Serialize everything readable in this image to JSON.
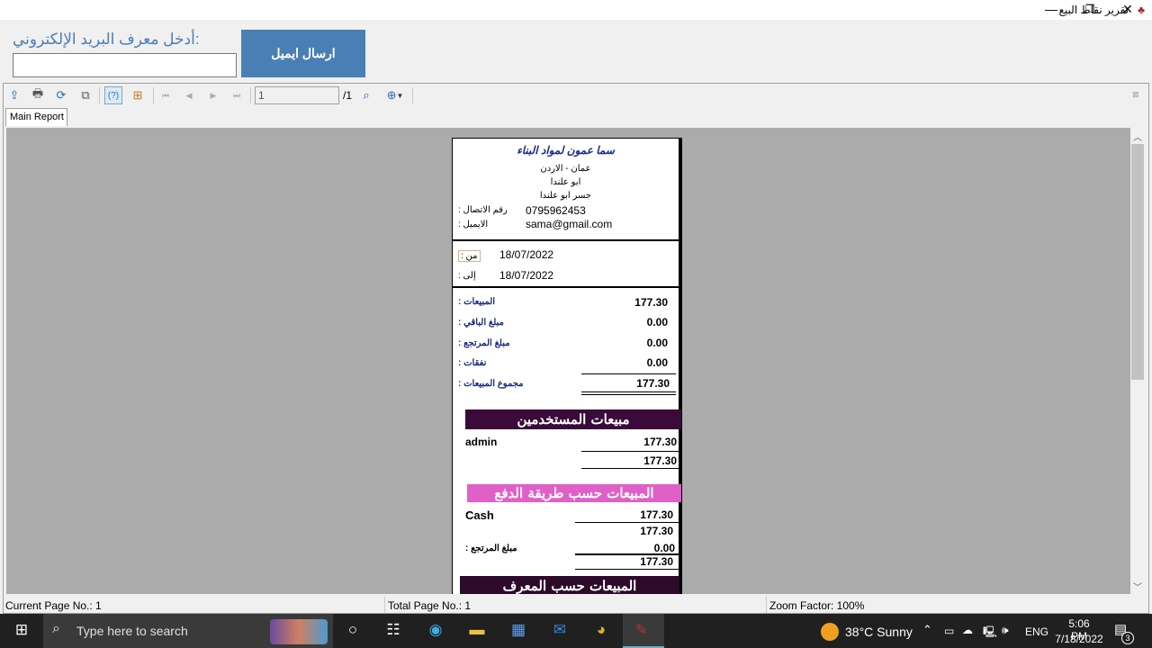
{
  "window": {
    "title": "تقرير نقاط البيع",
    "icon": "app-icon",
    "minimize": "—",
    "maximize": "❐",
    "close": "✕"
  },
  "header": {
    "email_label": ":أدخل معرف البريد الإلكتروني",
    "email_value": "",
    "send_button": "ارسال ايميل",
    "button_color": "#4a7fb5"
  },
  "toolbar": {
    "page_value": "1",
    "page_total": "/1",
    "icons": [
      "export-icon",
      "print-icon",
      "refresh-icon",
      "copy-icon",
      "help-icon",
      "group-tree-icon",
      "first-page-icon",
      "prev-page-icon",
      "next-page-icon",
      "last-page-icon",
      "find-icon",
      "zoom-icon"
    ]
  },
  "tabs": [
    {
      "label": "Main Report"
    }
  ],
  "report": {
    "company": "سما عمون لمواد البناء",
    "address": [
      "عمان - الاردن",
      "ابو علندا",
      "جسر ابو علندا"
    ],
    "phone_label": "رقم الاتصال :",
    "phone": "0795962453",
    "email_label": "الايميل :",
    "email": "sama@gmail.com",
    "from_label": "من :",
    "from": "18/07/2022",
    "to_label": "إلى :",
    "to": "18/07/2022",
    "summary": [
      {
        "label": "المبيعات :",
        "value": "177.30"
      },
      {
        "label": "مبلغ الباقي :",
        "value": "0.00"
      },
      {
        "label": "مبلغ المرتجع :",
        "value": "0.00"
      },
      {
        "label": "نفقات :",
        "value": "0.00"
      }
    ],
    "total_label": "مجموع المبيعات :",
    "total": "177.30",
    "users_title": "مبيعات المستخدمين",
    "users_color": "#3a0a3a",
    "users": [
      {
        "name": "admin",
        "value": "177.30"
      }
    ],
    "users_total": "177.30",
    "payment_title": "المبيعات حسب طريقة الدفع",
    "payment_color": "#e060c8",
    "payments": [
      {
        "name": "Cash",
        "value": "177.30"
      }
    ],
    "payment_total": "177.30",
    "returns_label": "مبلغ المرتجع :",
    "returns": "0.00",
    "net": "177.30",
    "by_id_title": "المبيعات حسب المعرف",
    "by_id_color": "#2e0a2a"
  },
  "status": {
    "current": "Current Page No.: 1",
    "total": "Total Page No.: 1",
    "zoom": "Zoom Factor: 100%"
  },
  "taskbar": {
    "search_placeholder": "Type here to search",
    "weather": "38°C  Sunny",
    "lang": "ENG",
    "time": "5:06 PM",
    "date": "7/18/2022",
    "notifications": "3"
  }
}
